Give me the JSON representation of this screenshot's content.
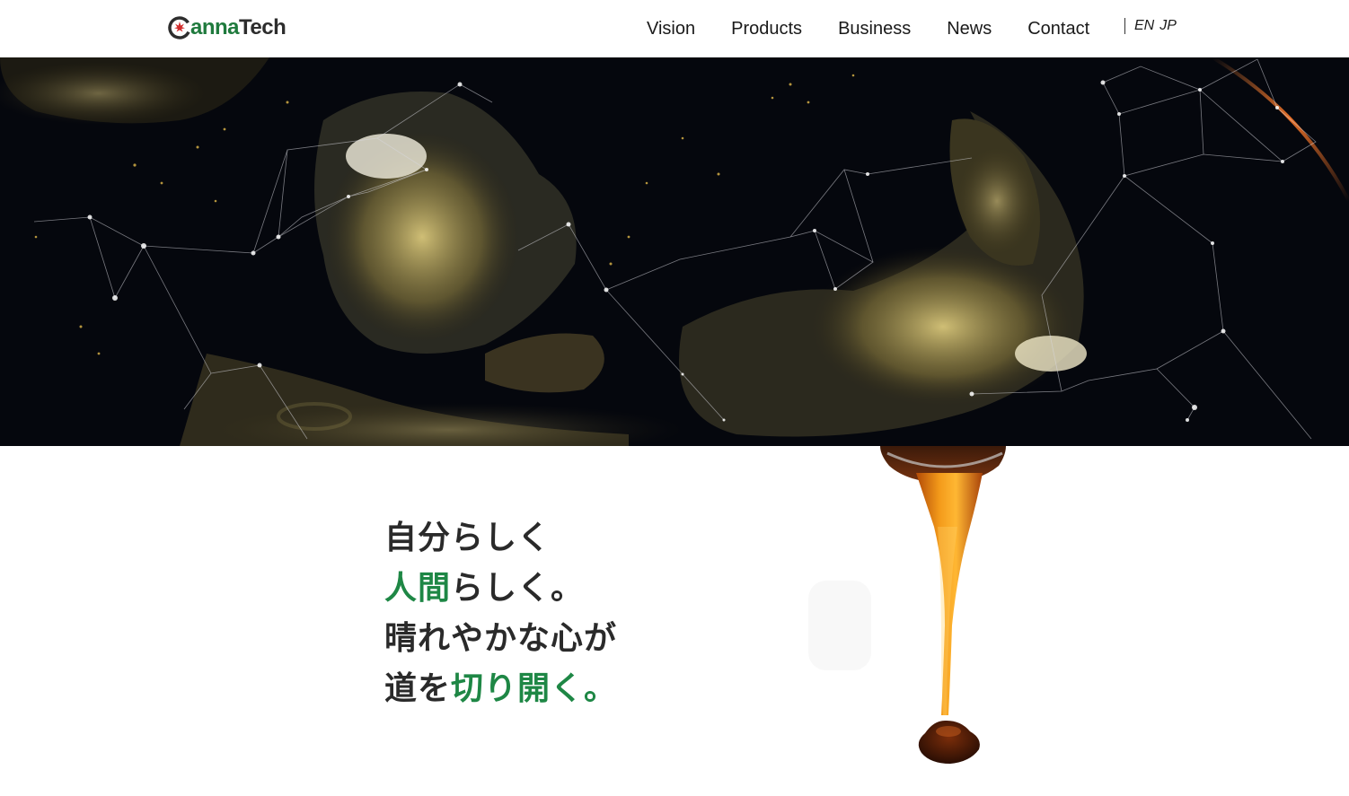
{
  "brand": {
    "logo_text_c": "C",
    "logo_text_anna": "anna",
    "logo_text_tech": "Tech",
    "colors": {
      "green": "#1e8745",
      "red": "#d12b2b",
      "dark": "#2d2d2d"
    }
  },
  "nav": {
    "items": [
      {
        "label": "Vision"
      },
      {
        "label": "Products"
      },
      {
        "label": "Business"
      },
      {
        "label": "News"
      },
      {
        "label": "Contact"
      }
    ],
    "languages": [
      "EN",
      "JP"
    ]
  },
  "hero": {
    "icon": "night-earth-network-image"
  },
  "tagline": {
    "line1_a": "自分らしく",
    "line2_green": "人間",
    "line2_b": "らしく。",
    "line3": "晴れやかな心が",
    "line4_a": "道を",
    "line4_green": "切り開く。",
    "line4_b": "",
    "line4_dot": ""
  },
  "product_image": {
    "icon": "honey-pour-image"
  }
}
